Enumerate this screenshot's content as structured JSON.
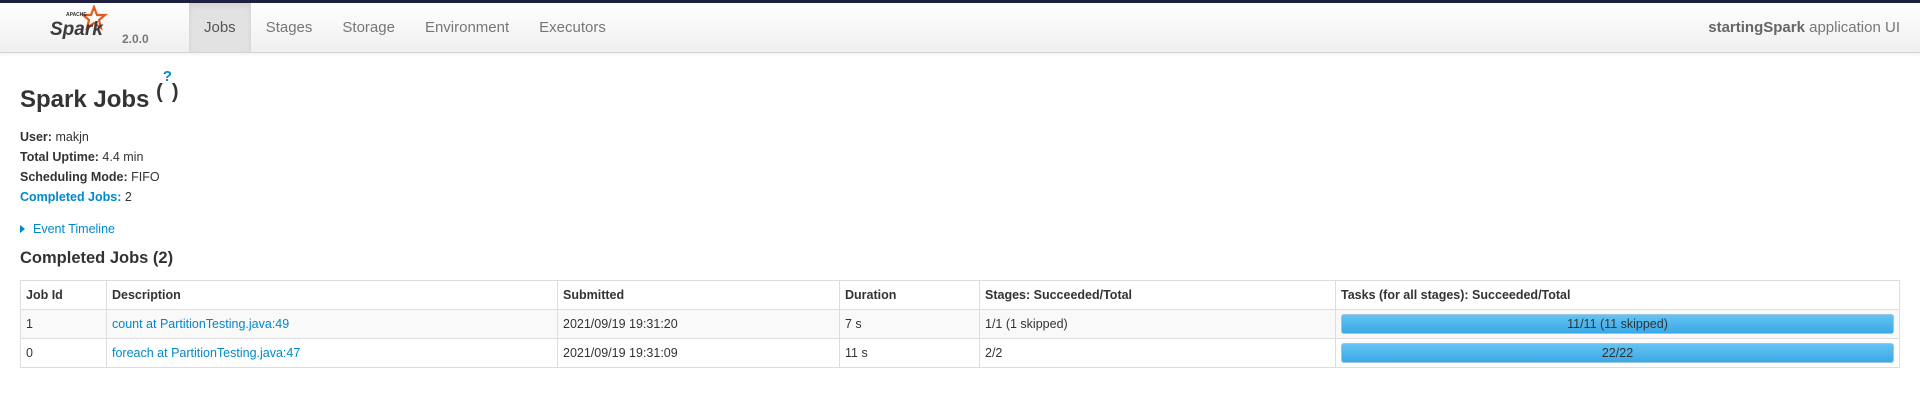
{
  "header": {
    "brand_tagline": "APACHE",
    "brand_name": "Spark",
    "version": "2.0.0",
    "nav_items": [
      "Jobs",
      "Stages",
      "Storage",
      "Environment",
      "Executors"
    ],
    "active_tab": "Jobs",
    "app_name": "startingSpark",
    "app_suffix": "application UI"
  },
  "page": {
    "title": "Spark Jobs",
    "help_marker": "?"
  },
  "summary": {
    "user_label": "User:",
    "user_value": "makjn",
    "uptime_label": "Total Uptime:",
    "uptime_value": "4.4 min",
    "mode_label": "Scheduling Mode:",
    "mode_value": "FIFO",
    "completed_label": "Completed Jobs:",
    "completed_value": "2"
  },
  "timeline": {
    "label": "Event Timeline"
  },
  "completed_jobs": {
    "heading": "Completed Jobs (2)",
    "columns": [
      "Job Id",
      "Description",
      "Submitted",
      "Duration",
      "Stages: Succeeded/Total",
      "Tasks (for all stages): Succeeded/Total"
    ],
    "rows": [
      {
        "job_id": "1",
        "description": "count at PartitionTesting.java:49",
        "submitted": "2021/09/19 19:31:20",
        "duration": "7 s",
        "stages": "1/1 (1 skipped)",
        "tasks": "11/11 (11 skipped)",
        "tasks_progress": 1.0
      },
      {
        "job_id": "0",
        "description": "foreach at PartitionTesting.java:47",
        "submitted": "2021/09/19 19:31:09",
        "duration": "11 s",
        "stages": "2/2",
        "tasks": "22/22",
        "tasks_progress": 1.0
      }
    ]
  },
  "colors": {
    "link": "#0088cc",
    "progress_fill": "#3aa8e6",
    "brand_star": "#e25a1c"
  }
}
